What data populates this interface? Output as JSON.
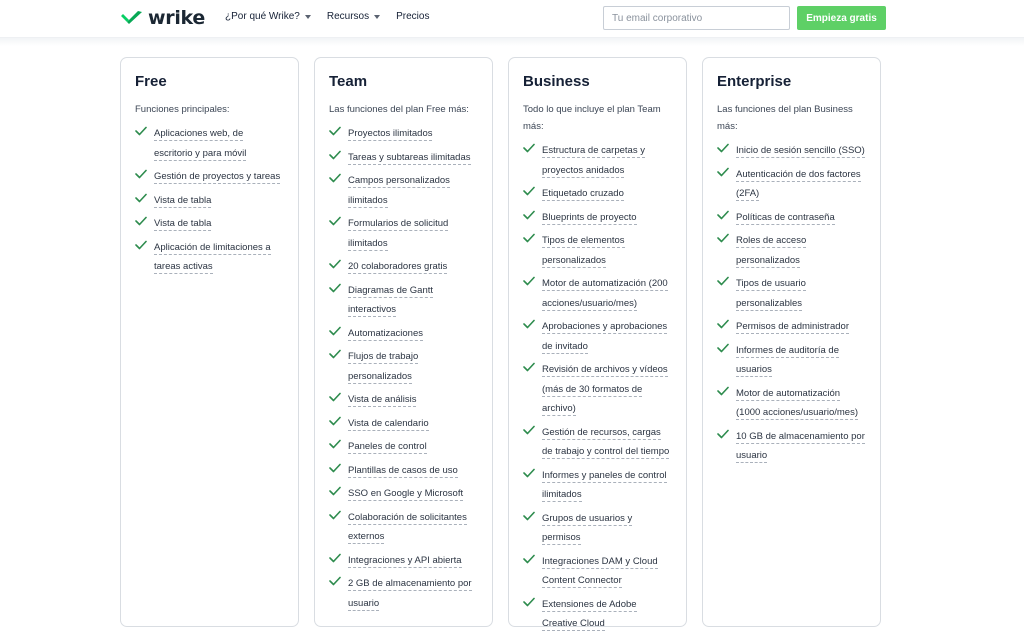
{
  "header": {
    "logo_text": "wrike",
    "nav": [
      {
        "label": "¿Por qué Wrike?",
        "has_dropdown": true
      },
      {
        "label": "Recursos",
        "has_dropdown": true
      },
      {
        "label": "Precios",
        "has_dropdown": false
      }
    ],
    "email_placeholder": "Tu email corporativo",
    "cta_label": "Empieza gratis"
  },
  "colors": {
    "brand_green": "#5ed066",
    "check_green": "#2e8c4e",
    "text_dark": "#162136"
  },
  "plans": [
    {
      "name": "Free",
      "subtitle": "Funciones principales:",
      "features": [
        "Aplicaciones web, de escritorio y para móvil",
        "Gestión de proyectos y tareas",
        "Vista de tabla",
        "Vista de tabla",
        "Aplicación de limitaciones a tareas activas"
      ]
    },
    {
      "name": "Team",
      "subtitle": "Las funciones del plan Free más:",
      "features": [
        "Proyectos ilimitados",
        "Tareas y subtareas ilimitadas",
        "Campos personalizados ilimitados",
        "Formularios de solicitud ilimitados",
        "20 colaboradores gratis",
        "Diagramas de Gantt interactivos",
        "Automatizaciones",
        "Flujos de trabajo personalizados",
        "Vista de análisis",
        "Vista de calendario",
        "Paneles de control",
        "Plantillas de casos de uso",
        "SSO en Google y Microsoft",
        "Colaboración de solicitantes externos",
        "Integraciones y API abierta",
        "2 GB de almacenamiento por usuario"
      ]
    },
    {
      "name": "Business",
      "subtitle": "Todo lo que incluye el plan Team más:",
      "features": [
        "Estructura de carpetas y proyectos anidados",
        "Etiquetado cruzado",
        "Blueprints de proyecto",
        "Tipos de elementos personalizados",
        "Motor de automatización (200 acciones/usuario/mes)",
        "Aprobaciones y aprobaciones de invitado",
        "Revisión de archivos y vídeos (más de 30 formatos de archivo)",
        "Gestión de recursos, cargas de trabajo y control del tiempo",
        "Informes y paneles de control ilimitados",
        "Grupos de usuarios y permisos",
        "Integraciones DAM y Cloud Content Connector",
        "Extensiones de Adobe Creative Cloud"
      ]
    },
    {
      "name": "Enterprise",
      "subtitle": "Las funciones del plan Business más:",
      "features": [
        "Inicio de sesión sencillo (SSO)",
        "Autenticación de dos factores (2FA)",
        "Políticas de contraseña",
        "Roles de acceso personalizados",
        "Tipos de usuario personalizables",
        "Permisos de administrador",
        "Informes de auditoría de usuarios",
        "Motor de automatización (1000 acciones/usuario/mes)",
        "10 GB de almacenamiento por usuario"
      ]
    }
  ]
}
